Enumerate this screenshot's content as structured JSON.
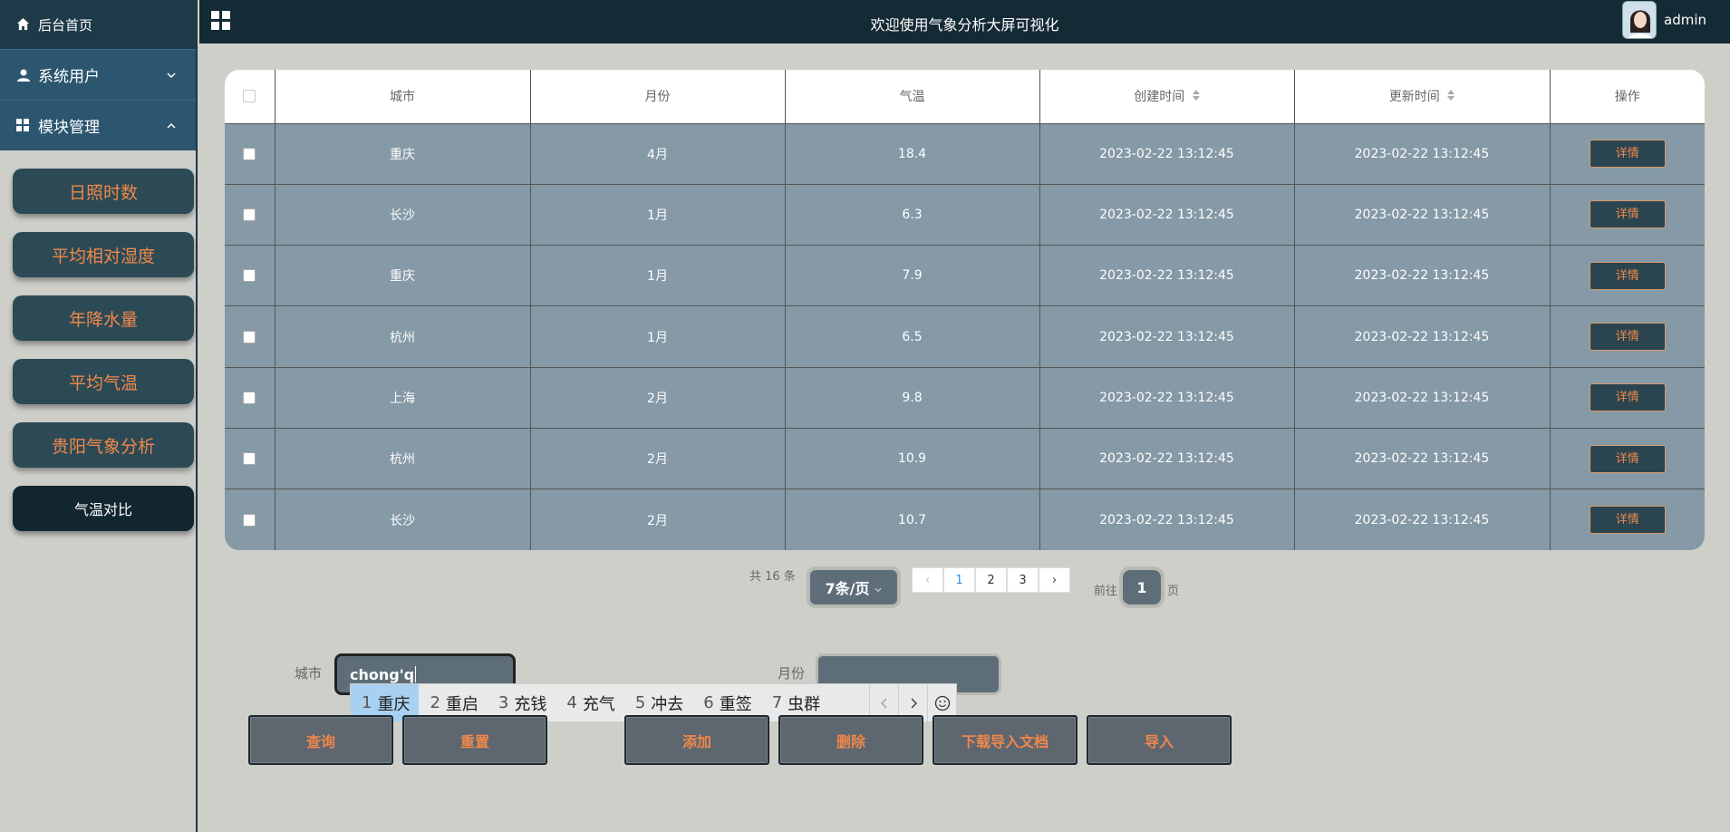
{
  "header": {
    "title": "欢迎使用气象分析大屏可视化",
    "username": "admin"
  },
  "sidebar": {
    "home": "后台首页",
    "groups": [
      {
        "label": "系统用户",
        "chevron": "chevron-down"
      },
      {
        "label": "模块管理",
        "chevron": "chevron-up"
      }
    ],
    "buttons": [
      {
        "label": "日照时数"
      },
      {
        "label": "平均相对湿度"
      },
      {
        "label": "年降水量"
      },
      {
        "label": "平均气温"
      },
      {
        "label": "贵阳气象分析"
      },
      {
        "label": "气温对比"
      }
    ]
  },
  "table": {
    "headers": [
      "城市",
      "月份",
      "气温",
      "创建时间",
      "更新时间",
      "操作"
    ],
    "action_label": "详情",
    "rows": [
      {
        "city": "重庆",
        "month": "4月",
        "temp": "18.4",
        "created": "2023-02-22 13:12:45",
        "updated": "2023-02-22 13:12:45"
      },
      {
        "city": "长沙",
        "month": "1月",
        "temp": "6.3",
        "created": "2023-02-22 13:12:45",
        "updated": "2023-02-22 13:12:45"
      },
      {
        "city": "重庆",
        "month": "1月",
        "temp": "7.9",
        "created": "2023-02-22 13:12:45",
        "updated": "2023-02-22 13:12:45"
      },
      {
        "city": "杭州",
        "month": "1月",
        "temp": "6.5",
        "created": "2023-02-22 13:12:45",
        "updated": "2023-02-22 13:12:45"
      },
      {
        "city": "上海",
        "month": "2月",
        "temp": "9.8",
        "created": "2023-02-22 13:12:45",
        "updated": "2023-02-22 13:12:45"
      },
      {
        "city": "杭州",
        "month": "2月",
        "temp": "10.9",
        "created": "2023-02-22 13:12:45",
        "updated": "2023-02-22 13:12:45"
      },
      {
        "city": "长沙",
        "month": "2月",
        "temp": "10.7",
        "created": "2023-02-22 13:12:45",
        "updated": "2023-02-22 13:12:45"
      }
    ]
  },
  "pagination": {
    "total": "共 16 条",
    "page_size": "7条/页",
    "pages": [
      "1",
      "2",
      "3"
    ],
    "current_page": "1",
    "goto_prefix": "前往",
    "goto_value": "1",
    "goto_suffix": "页"
  },
  "form": {
    "city_label": "城市",
    "city_value": "chong'q",
    "month_label": "月份",
    "month_value": ""
  },
  "actions": {
    "query": "查询",
    "reset": "重置",
    "add": "添加",
    "delete": "删除",
    "download": "下载导入文档",
    "import": "导入"
  },
  "ime": {
    "candidates": [
      {
        "num": "1",
        "text": "重庆"
      },
      {
        "num": "2",
        "text": "重启"
      },
      {
        "num": "3",
        "text": "充钱"
      },
      {
        "num": "4",
        "text": "充气"
      },
      {
        "num": "5",
        "text": "冲去"
      },
      {
        "num": "6",
        "text": "重签"
      },
      {
        "num": "7",
        "text": "虫群"
      }
    ],
    "selected_index": 0
  },
  "colors": {
    "header_bg": "#142a34",
    "sidebar_group_bg": "#2c5670",
    "accent_orange": "#f0884a",
    "table_row_bg": "#8599a6"
  }
}
